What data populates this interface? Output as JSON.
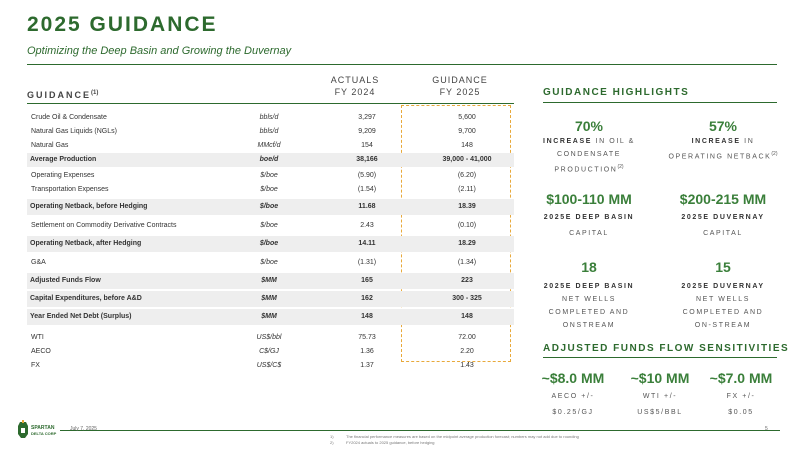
{
  "header": {
    "title": "2025 GUIDANCE",
    "subtitle": "Optimizing the Deep Basin and Growing the Duvernay"
  },
  "table": {
    "label": "GUIDANCE",
    "label_sup": "(1)",
    "col_actuals": [
      "ACTUALS",
      "FY 2024"
    ],
    "col_guidance": [
      "GUIDANCE",
      "FY 2025"
    ],
    "rows": [
      {
        "label": "Crude Oil & Condensate",
        "unit": "bbls/d",
        "actual": "3,297",
        "guidance": "5,600"
      },
      {
        "label": "Natural Gas Liquids (NGLs)",
        "unit": "bbls/d",
        "actual": "9,209",
        "guidance": "9,700"
      },
      {
        "label": "Natural Gas",
        "unit": "MMcf/d",
        "actual": "154",
        "guidance": "148"
      },
      {
        "label": "Average Production",
        "unit": "boe/d",
        "actual": "38,166",
        "guidance": "39,000 - 41,000"
      },
      {
        "label": "Operating Expenses",
        "unit": "$/boe",
        "actual": "(5.90)",
        "guidance": "(6.20)"
      },
      {
        "label": "Transportation Expenses",
        "unit": "$/boe",
        "actual": "(1.54)",
        "guidance": "(2.11)"
      },
      {
        "label": "Operating Netback, before Hedging",
        "unit": "$/boe",
        "actual": "11.68",
        "guidance": "18.39"
      },
      {
        "label": "Settlement on Commodity Derivative Contracts",
        "unit": "$/boe",
        "actual": "2.43",
        "guidance": "(0.10)"
      },
      {
        "label": "Operating Netback, after Hedging",
        "unit": "$/boe",
        "actual": "14.11",
        "guidance": "18.29"
      },
      {
        "label": "G&A",
        "unit": "$/boe",
        "actual": "(1.31)",
        "guidance": "(1.34)"
      },
      {
        "label": "Adjusted Funds Flow",
        "unit": "$MM",
        "actual": "165",
        "guidance": "223"
      },
      {
        "label": "Capital Expenditures, before A&D",
        "unit": "$MM",
        "actual": "162",
        "guidance": "300 - 325"
      },
      {
        "label": "Year Ended Net Debt (Surplus)",
        "unit": "$MM",
        "actual": "148",
        "guidance": "148"
      },
      {
        "label": "WTI",
        "unit": "US$/bbl",
        "actual": "75.73",
        "guidance": "72.00"
      },
      {
        "label": "AECO",
        "unit": "C$/GJ",
        "actual": "1.36",
        "guidance": "2.20"
      },
      {
        "label": "FX",
        "unit": "US$/C$",
        "actual": "1.37",
        "guidance": "1.43"
      }
    ]
  },
  "highlights": {
    "heading": "GUIDANCE HIGHLIGHTS",
    "items": [
      {
        "value": "70%",
        "bold": "INCREASE",
        "rest": " IN OIL & CONDENSATE PRODUCTION",
        "sup": "(2)"
      },
      {
        "value": "57%",
        "bold": "INCREASE",
        "rest": " IN OPERATING NETBACK",
        "sup": "(2)"
      },
      {
        "value": "$100-110 MM",
        "line1": "2025E DEEP BASIN",
        "line2": "CAPITAL"
      },
      {
        "value": "$200-215 MM",
        "line1": "2025E DUVERNAY",
        "line2": "CAPITAL"
      },
      {
        "value": "18",
        "line1": "2025E DEEP BASIN",
        "line2": "NET WELLS",
        "line3": "COMPLETED AND",
        "line4": "ONSTREAM"
      },
      {
        "value": "15",
        "line1": "2025E DUVERNAY",
        "line2": "NET WELLS",
        "line3": "COMPLETED AND",
        "line4": "ON-STREAM"
      }
    ]
  },
  "sensitivities": {
    "heading": "ADJUSTED FUNDS FLOW SENSITIVITIES",
    "items": [
      {
        "value": "~$8.0 MM",
        "line1": "AECO +/-",
        "line2": "$0.25/GJ"
      },
      {
        "value": "~$10 MM",
        "line1": "WTI +/-",
        "line2": "US$5/BBL"
      },
      {
        "value": "~$7.0 MM",
        "line1": "FX +/-",
        "line2": "$0.05"
      }
    ]
  },
  "footer": {
    "date": "July 7, 2025",
    "page": "5",
    "notes": [
      {
        "num": "1)",
        "text": "The financial performance measures are based on the midpoint average production forecast; numbers may not add due to rounding"
      },
      {
        "num": "2)",
        "text": "FY2024 actuals to 2025 guidance, before hedging"
      }
    ],
    "logo_text": [
      "SPARTAN",
      "DELTA CORP"
    ]
  },
  "colors": {
    "brand_green": "#2d6a2e",
    "value_green": "#3a7f3a",
    "guidance_box": "#e8a93b"
  }
}
